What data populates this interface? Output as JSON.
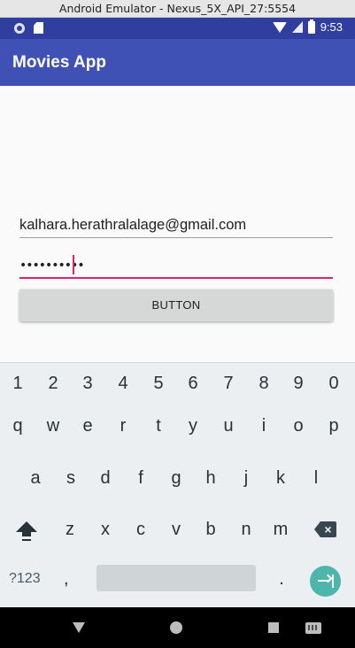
{
  "window": {
    "title": "Android Emulator - Nexus_5X_API_27:5554"
  },
  "status_bar": {
    "time": "9:53",
    "icons": [
      "notification-dot-icon",
      "sd-card-icon",
      "wifi-icon",
      "signal-icon",
      "battery-icon"
    ],
    "color": "#303f9f"
  },
  "app_bar": {
    "title": "Movies App",
    "color": "#3f51b5"
  },
  "form": {
    "email_value": "kalhara.herathralalage@gmail.com",
    "password_value": "••••••••••",
    "button_label": "BUTTON",
    "accent_color": "#e91e63"
  },
  "keyboard": {
    "number_row": [
      "1",
      "2",
      "3",
      "4",
      "5",
      "6",
      "7",
      "8",
      "9",
      "0"
    ],
    "row1": [
      "q",
      "w",
      "e",
      "r",
      "t",
      "y",
      "u",
      "i",
      "o",
      "p"
    ],
    "row2": [
      "a",
      "s",
      "d",
      "f",
      "g",
      "h",
      "j",
      "k",
      "l"
    ],
    "row3": [
      "z",
      "x",
      "c",
      "v",
      "b",
      "n",
      "m"
    ],
    "symbols_label": "?123",
    "comma": ",",
    "period": ".",
    "enter_color": "#4db6ac",
    "icons": [
      "shift-icon",
      "backspace-icon",
      "enter-icon"
    ]
  },
  "nav_bar": {
    "icons": [
      "back-icon",
      "home-icon",
      "recent-apps-icon",
      "keyboard-switch-icon"
    ]
  }
}
